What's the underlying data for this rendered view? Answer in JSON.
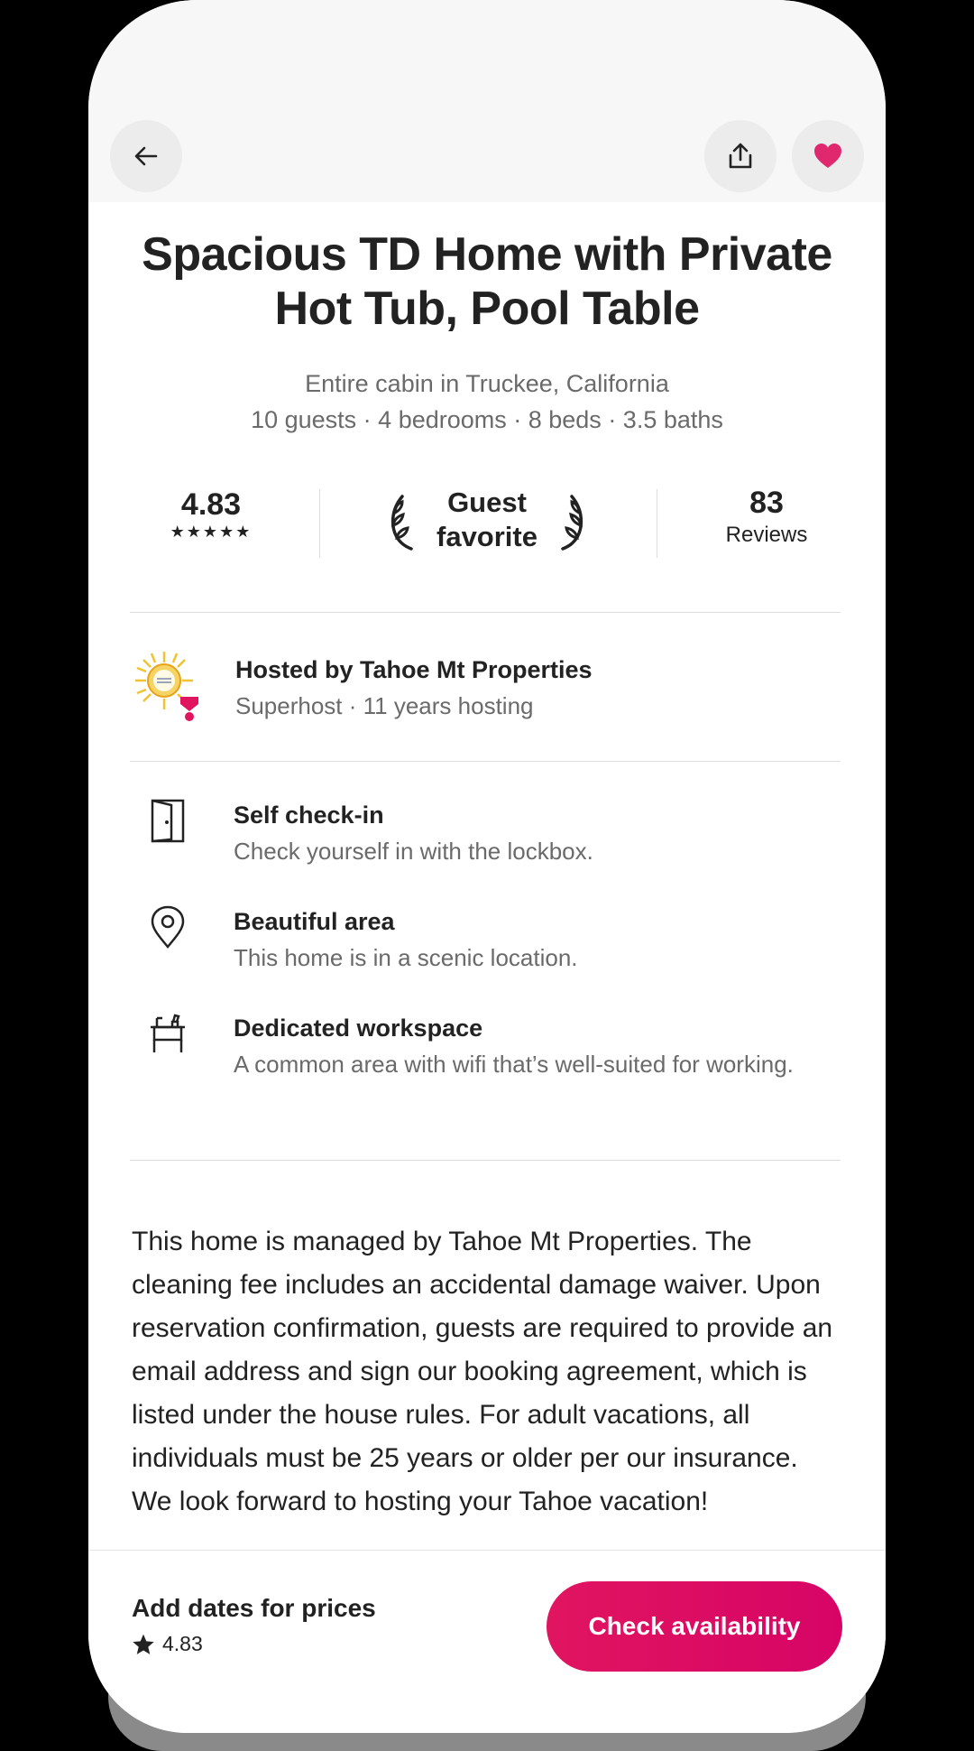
{
  "header": {
    "back_icon": "arrow-left-icon",
    "share_icon": "share-icon",
    "favorite_icon": "heart-icon",
    "favorite_color": "#e0286e"
  },
  "listing": {
    "title": "Spacious TD Home with Private Hot Tub, Pool Table",
    "location": "Entire cabin in Truckee, California",
    "details": "10 guests · 4 bedrooms · 8 beds · 3.5 baths"
  },
  "stats": {
    "rating": "4.83",
    "stars": "★★★★★",
    "favorite_label": "Guest favorite",
    "reviews_count": "83",
    "reviews_label": "Reviews"
  },
  "host": {
    "title": "Hosted by Tahoe Mt Properties",
    "subtitle": "Superhost · 11 years hosting"
  },
  "features": [
    {
      "icon": "door-icon",
      "title": "Self check-in",
      "desc": "Check yourself in with the lockbox."
    },
    {
      "icon": "location-pin-icon",
      "title": "Beautiful area",
      "desc": "This home is in a scenic location."
    },
    {
      "icon": "desk-icon",
      "title": "Dedicated workspace",
      "desc": "A common area with wifi that’s well-suited for working."
    }
  ],
  "description": {
    "para1": "This home is managed by Tahoe Mt Properties. The cleaning fee includes an accidental damage waiver. Upon reservation confirmation, guests are required to provide an email address and sign our booking agreement, which is listed under the house rules. For adult vacations, all individuals must be 25 years or older per our insurance.",
    "para2": "We look forward to hosting your Tahoe vacation!"
  },
  "footer": {
    "title": "Add dates for prices",
    "rating": "4.83",
    "cta_label": "Check availability",
    "cta_color": "#dc0c62"
  }
}
